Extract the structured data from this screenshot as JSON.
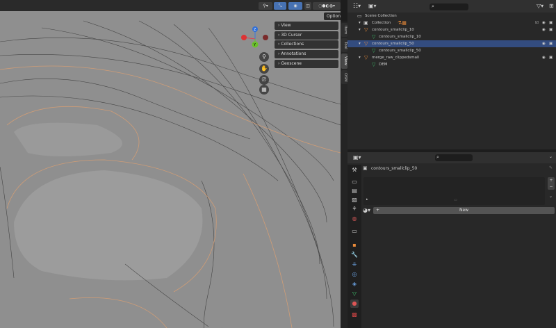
{
  "viewport": {
    "options_label": "Options",
    "npanel": [
      "View",
      "3D Cursor",
      "Collections",
      "Annotations",
      "Geoscene"
    ],
    "ntabs": [
      "Item",
      "Tool",
      "View",
      "OSM"
    ],
    "gizmo": {
      "z": "Z",
      "y": "Y",
      "x": "X"
    }
  },
  "outliner": {
    "items": [
      {
        "label": "Scene Collection"
      },
      {
        "label": "Collection"
      },
      {
        "label": "contours_smallclip_10"
      },
      {
        "label": "contours_smallclip_10"
      },
      {
        "label": "contours_smallclip_50"
      },
      {
        "label": "contours_smallclip_50"
      },
      {
        "label": "merge_raw_clippedsmall"
      },
      {
        "label": "DEM"
      }
    ]
  },
  "properties": {
    "object_name": "contours_smallclip_50",
    "new_label": "New"
  },
  "colors": {
    "selected": "#334c7f",
    "accent": "#4772b3",
    "orange": "#e88a3a",
    "green": "#3dbd6a"
  }
}
